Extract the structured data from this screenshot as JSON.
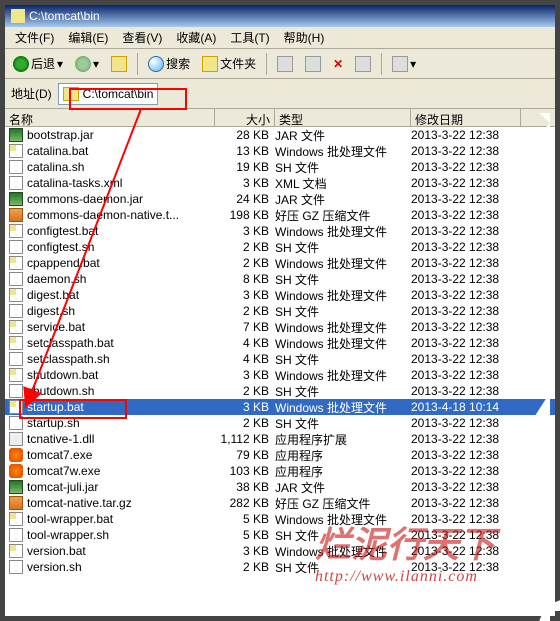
{
  "title": "C:\\tomcat\\bin",
  "menu": {
    "file": "文件(F)",
    "edit": "编辑(E)",
    "view": "查看(V)",
    "fav": "收藏(A)",
    "tools": "工具(T)",
    "help": "帮助(H)"
  },
  "toolbar": {
    "back": "后退",
    "search": "搜索",
    "folders": "文件夹"
  },
  "address": {
    "label": "地址(D)",
    "path": "C:\\tomcat\\bin"
  },
  "columns": {
    "name": "名称",
    "size": "大小",
    "type": "类型",
    "date": "修改日期"
  },
  "files": [
    {
      "n": "bootstrap.jar",
      "s": "28 KB",
      "t": "JAR 文件",
      "d": "2013-3-22 12:38",
      "ic": "ic-jar"
    },
    {
      "n": "catalina.bat",
      "s": "13 KB",
      "t": "Windows 批处理文件",
      "d": "2013-3-22 12:38",
      "ic": "ic-bat"
    },
    {
      "n": "catalina.sh",
      "s": "19 KB",
      "t": "SH 文件",
      "d": "2013-3-22 12:38",
      "ic": "ic-sh"
    },
    {
      "n": "catalina-tasks.xml",
      "s": "3 KB",
      "t": "XML 文档",
      "d": "2013-3-22 12:38",
      "ic": "ic-xml"
    },
    {
      "n": "commons-daemon.jar",
      "s": "24 KB",
      "t": "JAR 文件",
      "d": "2013-3-22 12:38",
      "ic": "ic-jar"
    },
    {
      "n": "commons-daemon-native.t...",
      "s": "198 KB",
      "t": "好压 GZ 压缩文件",
      "d": "2013-3-22 12:38",
      "ic": "ic-gz"
    },
    {
      "n": "configtest.bat",
      "s": "3 KB",
      "t": "Windows 批处理文件",
      "d": "2013-3-22 12:38",
      "ic": "ic-bat"
    },
    {
      "n": "configtest.sh",
      "s": "2 KB",
      "t": "SH 文件",
      "d": "2013-3-22 12:38",
      "ic": "ic-sh"
    },
    {
      "n": "cpappend.bat",
      "s": "2 KB",
      "t": "Windows 批处理文件",
      "d": "2013-3-22 12:38",
      "ic": "ic-bat"
    },
    {
      "n": "daemon.sh",
      "s": "8 KB",
      "t": "SH 文件",
      "d": "2013-3-22 12:38",
      "ic": "ic-sh"
    },
    {
      "n": "digest.bat",
      "s": "3 KB",
      "t": "Windows 批处理文件",
      "d": "2013-3-22 12:38",
      "ic": "ic-bat"
    },
    {
      "n": "digest.sh",
      "s": "2 KB",
      "t": "SH 文件",
      "d": "2013-3-22 12:38",
      "ic": "ic-sh"
    },
    {
      "n": "service.bat",
      "s": "7 KB",
      "t": "Windows 批处理文件",
      "d": "2013-3-22 12:38",
      "ic": "ic-bat"
    },
    {
      "n": "setclasspath.bat",
      "s": "4 KB",
      "t": "Windows 批处理文件",
      "d": "2013-3-22 12:38",
      "ic": "ic-bat"
    },
    {
      "n": "setclasspath.sh",
      "s": "4 KB",
      "t": "SH 文件",
      "d": "2013-3-22 12:38",
      "ic": "ic-sh"
    },
    {
      "n": "shutdown.bat",
      "s": "3 KB",
      "t": "Windows 批处理文件",
      "d": "2013-3-22 12:38",
      "ic": "ic-bat"
    },
    {
      "n": "shutdown.sh",
      "s": "2 KB",
      "t": "SH 文件",
      "d": "2013-3-22 12:38",
      "ic": "ic-sh"
    },
    {
      "n": "startup.bat",
      "s": "3 KB",
      "t": "Windows 批处理文件",
      "d": "2013-4-18 10:14",
      "ic": "ic-bat",
      "sel": true
    },
    {
      "n": "startup.sh",
      "s": "2 KB",
      "t": "SH 文件",
      "d": "2013-3-22 12:38",
      "ic": "ic-sh"
    },
    {
      "n": "tcnative-1.dll",
      "s": "1,112 KB",
      "t": "应用程序扩展",
      "d": "2013-3-22 12:38",
      "ic": "ic-dll"
    },
    {
      "n": "tomcat7.exe",
      "s": "79 KB",
      "t": "应用程序",
      "d": "2013-3-22 12:38",
      "ic": "ic-exe2"
    },
    {
      "n": "tomcat7w.exe",
      "s": "103 KB",
      "t": "应用程序",
      "d": "2013-3-22 12:38",
      "ic": "ic-exe2"
    },
    {
      "n": "tomcat-juli.jar",
      "s": "38 KB",
      "t": "JAR 文件",
      "d": "2013-3-22 12:38",
      "ic": "ic-jar"
    },
    {
      "n": "tomcat-native.tar.gz",
      "s": "282 KB",
      "t": "好压 GZ 压缩文件",
      "d": "2013-3-22 12:38",
      "ic": "ic-gz"
    },
    {
      "n": "tool-wrapper.bat",
      "s": "5 KB",
      "t": "Windows 批处理文件",
      "d": "2013-3-22 12:38",
      "ic": "ic-bat"
    },
    {
      "n": "tool-wrapper.sh",
      "s": "5 KB",
      "t": "SH 文件",
      "d": "2013-3-22 12:38",
      "ic": "ic-sh"
    },
    {
      "n": "version.bat",
      "s": "3 KB",
      "t": "Windows 批处理文件",
      "d": "2013-3-22 12:38",
      "ic": "ic-bat"
    },
    {
      "n": "version.sh",
      "s": "2 KB",
      "t": "SH 文件",
      "d": "2013-3-22 12:38",
      "ic": "ic-sh"
    }
  ],
  "watermark": {
    "cn": "烂泥行天下",
    "url": "http://www.ilanni.com"
  }
}
